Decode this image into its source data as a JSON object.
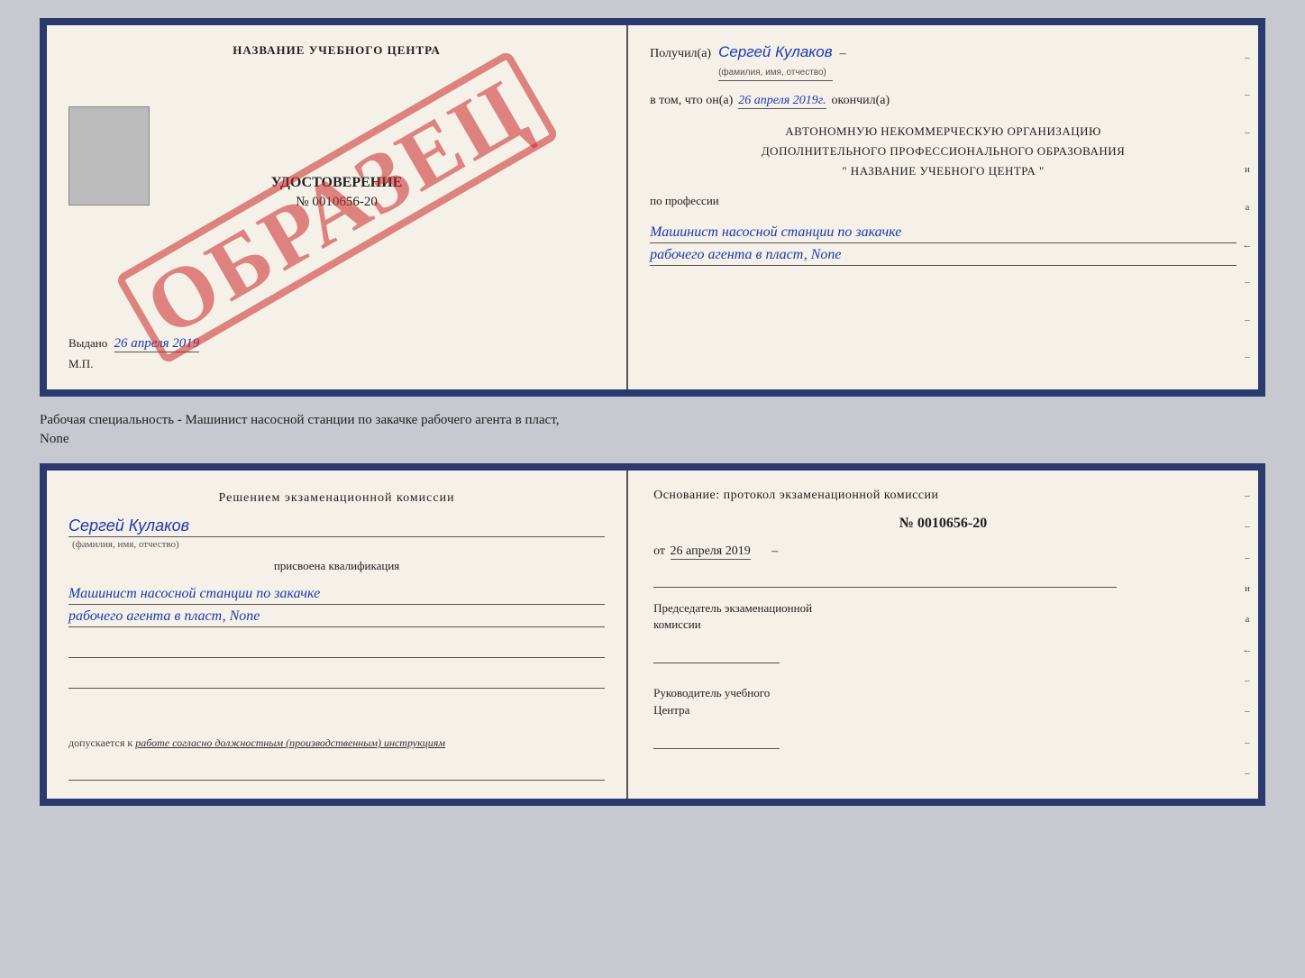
{
  "top_document": {
    "left": {
      "center_title": "НАЗВАНИЕ УЧЕБНОГО ЦЕНТРА",
      "udostoverenie_label": "УДОСТОВЕРЕНИЕ",
      "nomer": "№ 0010656-20",
      "vydano_label": "Выдано",
      "vydano_date": "26 апреля 2019",
      "mp_label": "М.П.",
      "obrazec_text": "ОБРАЗЕЦ"
    },
    "right": {
      "poluchil_label": "Получил(а)",
      "fio_value": "Сергей Кулаков",
      "fio_hint": "(фамилия, имя, отчество)",
      "dash": "–",
      "vtom_label": "в том, что он(а)",
      "date_value": "26 апреля 2019г.",
      "okonchil_label": "окончил(а)",
      "org_line1": "АВТОНОМНУЮ НЕКОММЕРЧЕСКУЮ ОРГАНИЗАЦИЮ",
      "org_line2": "ДОПОЛНИТЕЛЬНОГО ПРОФЕССИОНАЛЬНОГО ОБРАЗОВАНИЯ",
      "org_line3": "\"   НАЗВАНИЕ УЧЕБНОГО ЦЕНТРА   \"",
      "po_professii_label": "по профессии",
      "profession_line1": "Машинист насосной станции по закачке",
      "profession_line2": "рабочего агента в пласт, None",
      "margin_marks": [
        "–",
        "–",
        "–",
        "и",
        "а",
        "←",
        "–",
        "–",
        "–"
      ]
    }
  },
  "middle_text": {
    "line1": "Рабочая специальность - Машинист насосной станции по закачке рабочего агента в пласт,",
    "line2": "None"
  },
  "bottom_document": {
    "left": {
      "resheniem_line1": "Решением  экзаменационной  комиссии",
      "fio_value": "Сергей Кулаков",
      "fio_hint": "(фамилия, имя, отчество)",
      "prisvoena_label": "присвоена квалификация",
      "qualification_line1": "Машинист насосной станции по закачке",
      "qualification_line2": "рабочего агента в пласт, None",
      "underline1": "",
      "underline2": "",
      "dopuskaetsya_label": "допускается к",
      "dopuskaetsya_italic": "работе согласно должностным (производственным) инструкциям",
      "underline3": ""
    },
    "right": {
      "osnovanie_label": "Основание: протокол экзаменационной  комиссии",
      "protokol_nomer": "№ 0010656-20",
      "ot_label": "от",
      "ot_date": "26 апреля 2019",
      "predsedatel_line1": "Председатель экзаменационной",
      "predsedatel_line2": "комиссии",
      "rukovoditel_line1": "Руководитель учебного",
      "rukovoditel_line2": "Центра",
      "margin_marks": [
        "–",
        "–",
        "–",
        "и",
        "а",
        "←",
        "–",
        "–",
        "–",
        "–"
      ]
    }
  }
}
